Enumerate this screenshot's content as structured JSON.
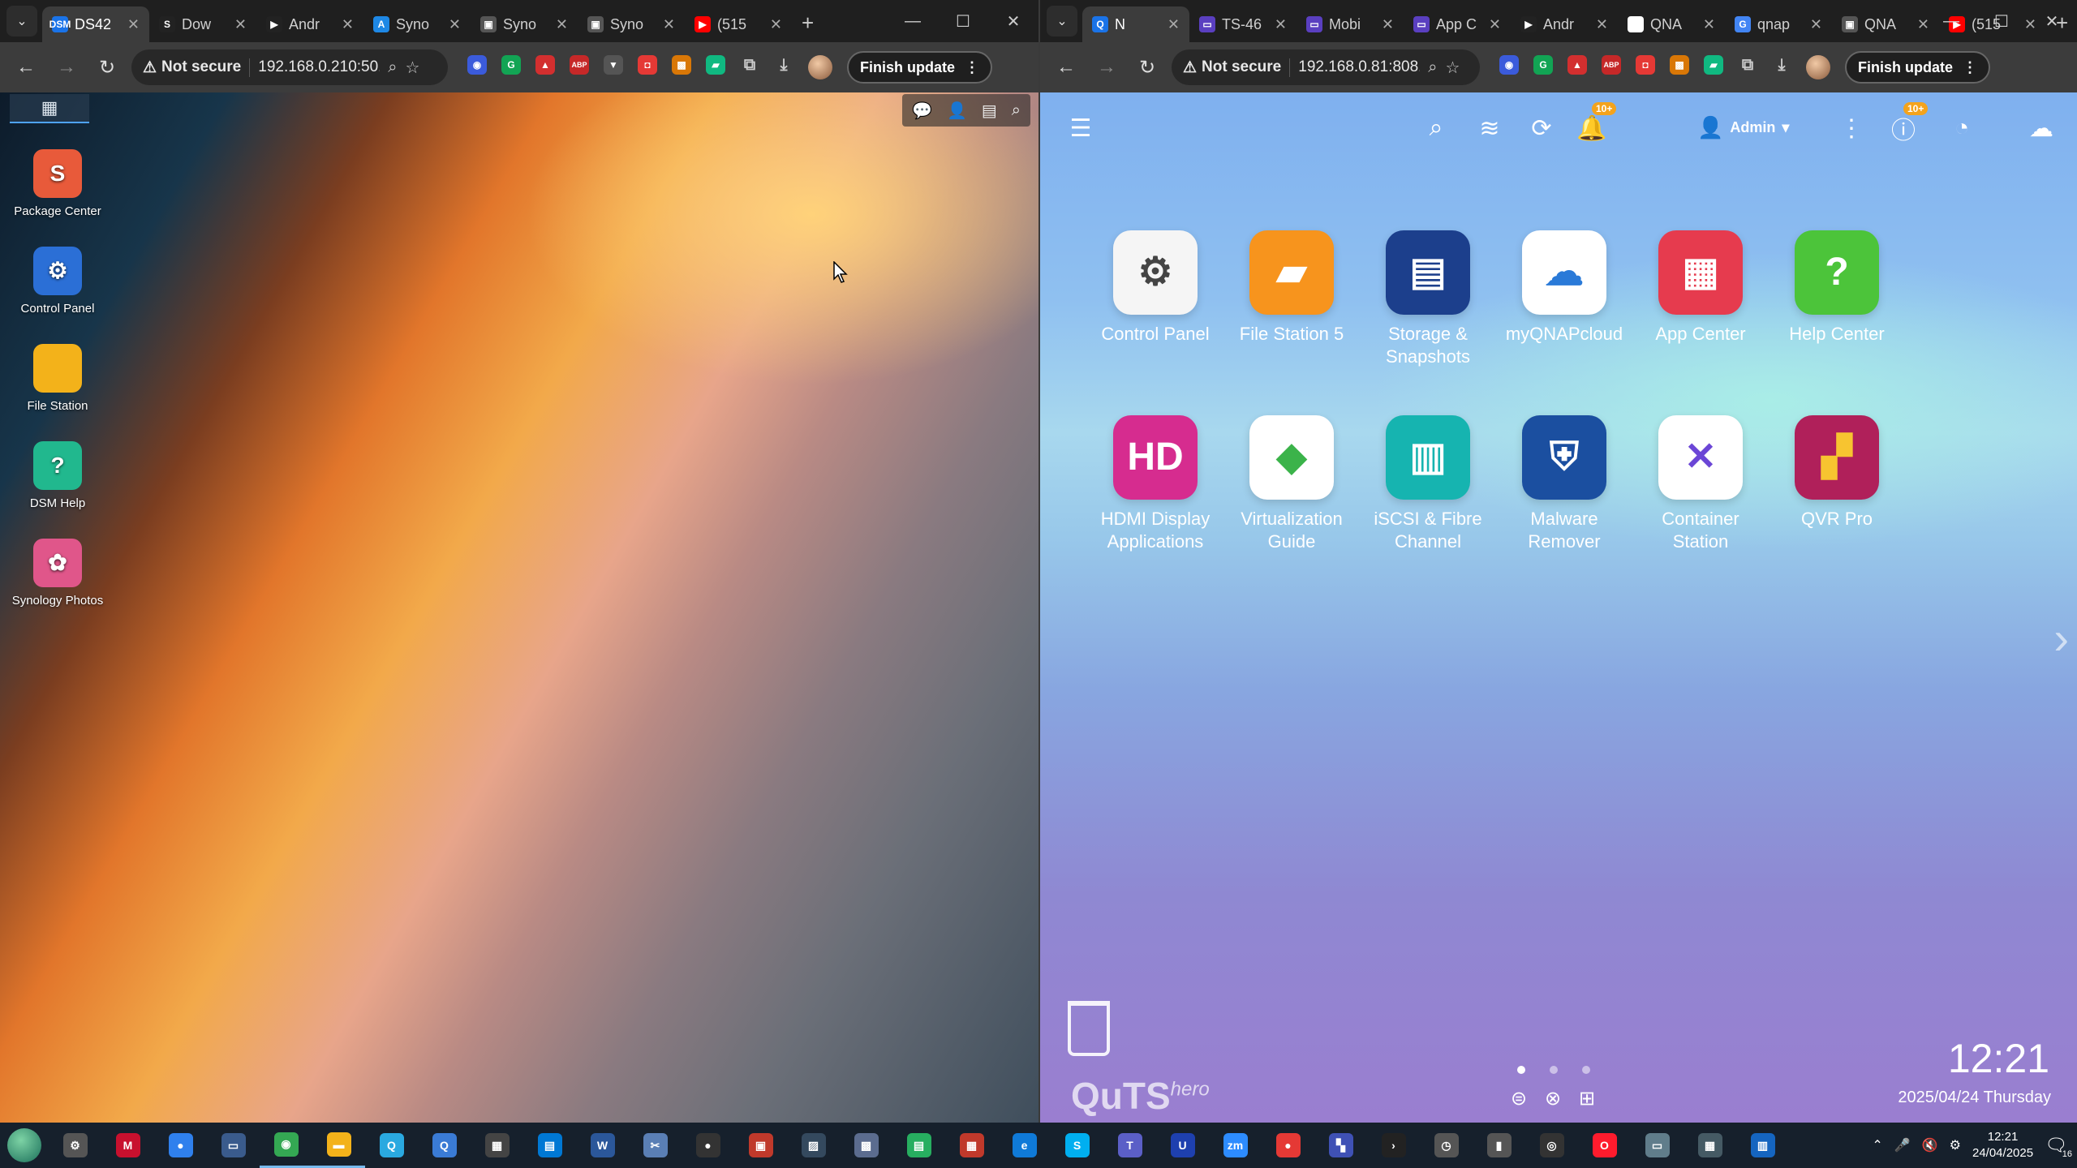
{
  "left_browser": {
    "tabs": [
      {
        "label": "DS42",
        "favicon": "DSM",
        "color": "#1a73e8",
        "active": true
      },
      {
        "label": "Dow",
        "favicon": "S",
        "color": "#222222"
      },
      {
        "label": "Andr",
        "favicon": "▶",
        "color": "#222222"
      },
      {
        "label": "Syno",
        "favicon": "A",
        "color": "#1e88e5"
      },
      {
        "label": "Syno",
        "favicon": "▣",
        "color": "#555555"
      },
      {
        "label": "Syno",
        "favicon": "▣",
        "color": "#555555"
      },
      {
        "label": "(515",
        "favicon": "▶",
        "color": "#ff0000"
      }
    ],
    "not_secure": "Not secure",
    "url": "192.168.0.210:50...",
    "finish_update": "Finish update"
  },
  "dsm": {
    "desktop_icons": [
      {
        "label": "Package Center",
        "icon": "package-center-icon",
        "glyph": "S",
        "color": "#e85a3a"
      },
      {
        "label": "Control Panel",
        "icon": "control-panel-icon",
        "glyph": "⚙",
        "color": "#2b6fd6"
      },
      {
        "label": "File Station",
        "icon": "file-station-icon",
        "glyph": "",
        "color": "#f3b21a"
      },
      {
        "label": "DSM Help",
        "icon": "dsm-help-icon",
        "glyph": "?",
        "color": "#21b88e"
      },
      {
        "label": "Synology Photos",
        "icon": "synology-photos-icon",
        "glyph": "✿",
        "color": "#e0568a"
      }
    ]
  },
  "right_browser": {
    "tabs": [
      {
        "label": "N",
        "favicon": "Q",
        "color": "#1a73e8",
        "active": true
      },
      {
        "label": "TS-46",
        "favicon": "▭",
        "color": "#5a3fc0"
      },
      {
        "label": "Mobi",
        "favicon": "▭",
        "color": "#5a3fc0"
      },
      {
        "label": "App C",
        "favicon": "▭",
        "color": "#5a3fc0"
      },
      {
        "label": "Andr",
        "favicon": "▶",
        "color": "#222222"
      },
      {
        "label": "QNA",
        "favicon": "●",
        "color": "#ffffff"
      },
      {
        "label": "qnap",
        "favicon": "G",
        "color": "#4285f4"
      },
      {
        "label": "QNA",
        "favicon": "▣",
        "color": "#555555"
      },
      {
        "label": "(515",
        "favicon": "▶",
        "color": "#ff0000"
      }
    ],
    "not_secure": "Not secure",
    "url": "192.168.0.81:808...",
    "finish_update": "Finish update"
  },
  "qts": {
    "user": "Admin",
    "notif_badge": "10+",
    "info_badge": "10+",
    "apps": [
      {
        "label": "Control Panel",
        "icon": "control-panel-icon",
        "glyph": "⚙",
        "bg": "#f5f5f5",
        "fg": "#444444"
      },
      {
        "label": "File Station 5",
        "icon": "file-station-icon",
        "glyph": "▰",
        "bg": "#f7941d",
        "fg": "#ffffff"
      },
      {
        "label": "Storage & Snapshots",
        "icon": "storage-snapshots-icon",
        "glyph": "▤",
        "bg": "#1c3f8c",
        "fg": "#ffffff"
      },
      {
        "label": "myQNAPcloud",
        "icon": "cloud-icon",
        "glyph": "☁",
        "bg": "#ffffff",
        "fg": "#2a7ad8"
      },
      {
        "label": "App Center",
        "icon": "app-center-icon",
        "glyph": "▦",
        "bg": "#e63b4e",
        "fg": "#ffffff"
      },
      {
        "label": "Help Center",
        "icon": "help-center-icon",
        "glyph": "?",
        "bg": "#4cc43a",
        "fg": "#ffffff"
      },
      {
        "label": "HDMI Display Applications",
        "icon": "hdmi-display-icon",
        "glyph": "HD",
        "bg": "#d62c8f",
        "fg": "#ffffff"
      },
      {
        "label": "Virtualization Guide",
        "icon": "virtualization-icon",
        "glyph": "◆",
        "bg": "#ffffff",
        "fg": "#3bb34a"
      },
      {
        "label": "iSCSI & Fibre Channel",
        "icon": "iscsi-icon",
        "glyph": "▥",
        "bg": "#16b4b0",
        "fg": "#ffffff"
      },
      {
        "label": "Malware Remover",
        "icon": "malware-remover-icon",
        "glyph": "⛨",
        "bg": "#1b4fa0",
        "fg": "#ffffff"
      },
      {
        "label": "Container Station",
        "icon": "container-station-icon",
        "glyph": "✕",
        "bg": "#ffffff",
        "fg": "#6b46d6"
      },
      {
        "label": "QVR Pro",
        "icon": "qvr-pro-icon",
        "glyph": "▞",
        "bg": "#b0205a",
        "fg": "#f7c430"
      }
    ],
    "logo_main": "QuTS",
    "logo_sup": "hero",
    "time": "12:21",
    "date": "2025/04/24 Thursday"
  },
  "taskbar": {
    "apps": [
      {
        "name": "settings",
        "glyph": "⚙",
        "color": "#555555"
      },
      {
        "name": "mcafee",
        "glyph": "M",
        "color": "#c8102e"
      },
      {
        "name": "dot",
        "glyph": "●",
        "color": "#2f80ed"
      },
      {
        "name": "window",
        "glyph": "▭",
        "color": "#3a5b8c"
      },
      {
        "name": "chrome",
        "glyph": "◉",
        "color": "#34a853",
        "running": true
      },
      {
        "name": "explorer",
        "glyph": "▬",
        "color": "#f3b21a",
        "running": true
      },
      {
        "name": "qfinder",
        "glyph": "Q",
        "color": "#2aa9e0"
      },
      {
        "name": "search",
        "glyph": "Q",
        "color": "#3a7bd5"
      },
      {
        "name": "calc",
        "glyph": "▦",
        "color": "#444444"
      },
      {
        "name": "store",
        "glyph": "▤",
        "color": "#0078d4"
      },
      {
        "name": "word",
        "glyph": "W",
        "color": "#2b579a"
      },
      {
        "name": "snip",
        "glyph": "✂",
        "color": "#5a7fb5"
      },
      {
        "name": "obs",
        "glyph": "●",
        "color": "#333333"
      },
      {
        "name": "app1",
        "glyph": "▣",
        "color": "#c0392b"
      },
      {
        "name": "app2",
        "glyph": "▨",
        "color": "#34495e"
      },
      {
        "name": "app3",
        "glyph": "▩",
        "color": "#5b6c8f"
      },
      {
        "name": "app4",
        "glyph": "▤",
        "color": "#27ae60"
      },
      {
        "name": "app5",
        "glyph": "▦",
        "color": "#c0392b"
      },
      {
        "name": "edge",
        "glyph": "e",
        "color": "#0f7ad8"
      },
      {
        "name": "skype",
        "glyph": "S",
        "color": "#00aff0"
      },
      {
        "name": "teams",
        "glyph": "T",
        "color": "#5b5fc7"
      },
      {
        "name": "u",
        "glyph": "U",
        "color": "#1e40af"
      },
      {
        "name": "zoom",
        "glyph": "zm",
        "color": "#2d8cff"
      },
      {
        "name": "rec",
        "glyph": "●",
        "color": "#e53935"
      },
      {
        "name": "net",
        "glyph": "▚",
        "color": "#3f51b5"
      },
      {
        "name": "plex",
        "glyph": "›",
        "color": "#222222"
      },
      {
        "name": "clock",
        "glyph": "◷",
        "color": "#555555"
      },
      {
        "name": "usb",
        "glyph": "▮",
        "color": "#555555"
      },
      {
        "name": "cam",
        "glyph": "◎",
        "color": "#333333"
      },
      {
        "name": "opera",
        "glyph": "O",
        "color": "#ff1b2d"
      },
      {
        "name": "shot",
        "glyph": "▭",
        "color": "#607d8b"
      },
      {
        "name": "calcx",
        "glyph": "▦",
        "color": "#455a64"
      },
      {
        "name": "bars",
        "glyph": "▥",
        "color": "#1565c0"
      }
    ],
    "time": "12:21",
    "date": "24/04/2025",
    "notif_count": "16"
  }
}
